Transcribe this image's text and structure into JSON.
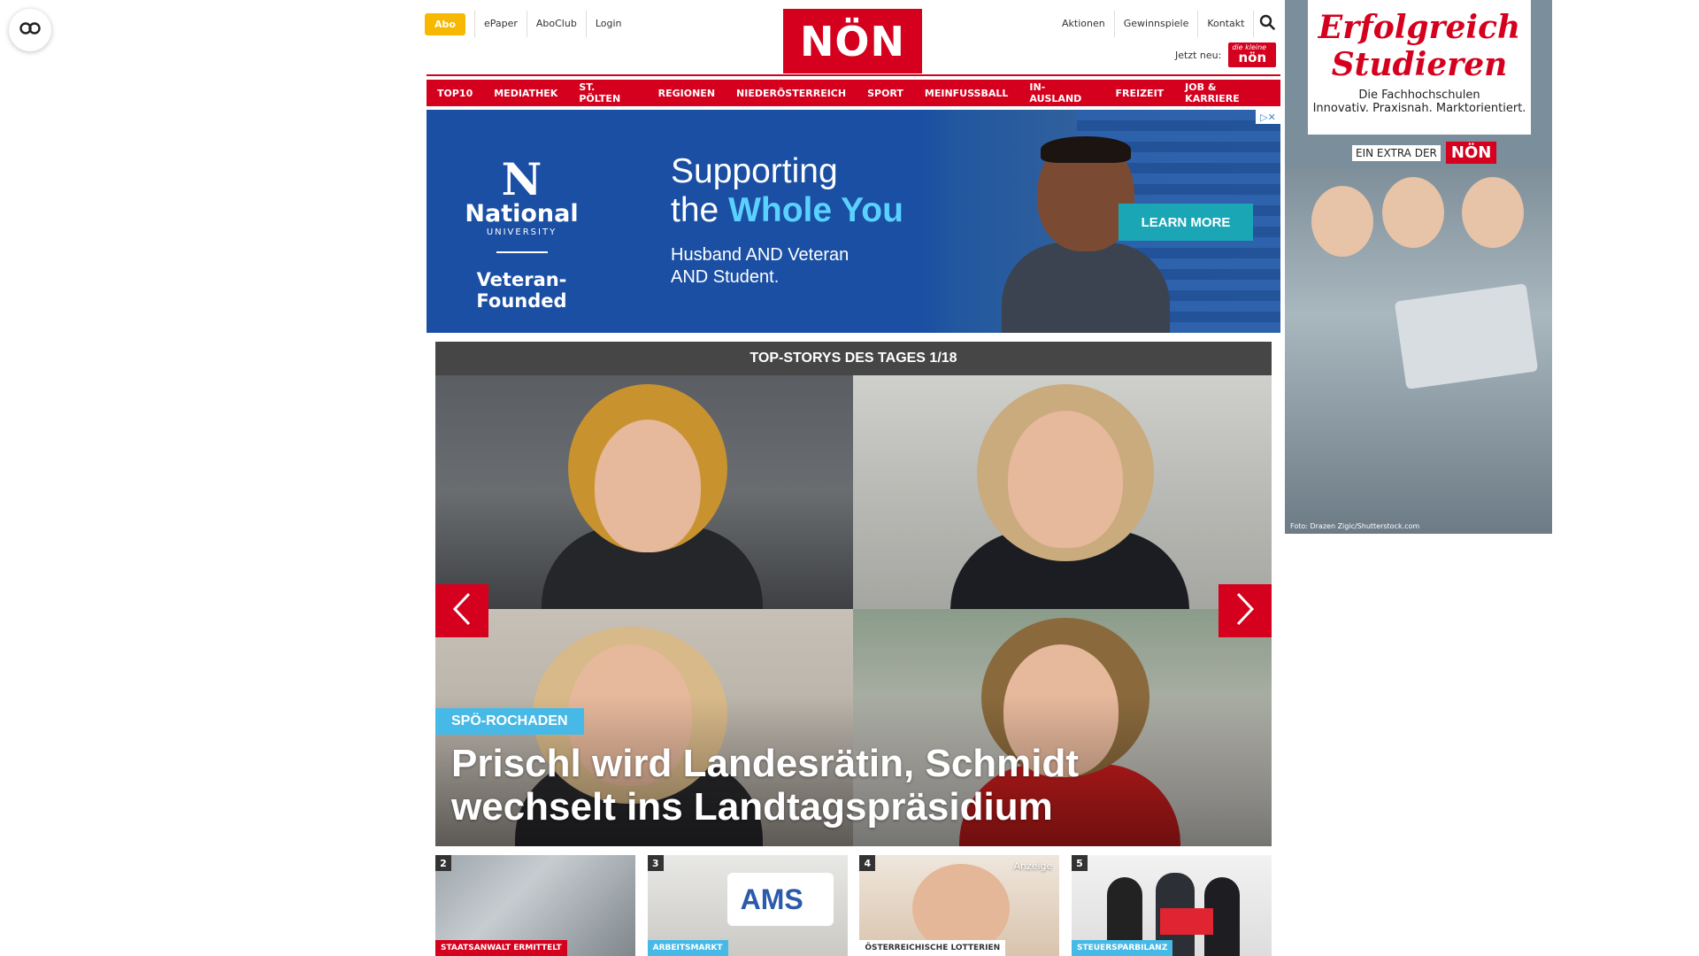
{
  "header": {
    "abo": "Abo",
    "top_links": [
      "ePaper",
      "AboClub",
      "Login"
    ],
    "logo": "NÖN",
    "right_links": [
      "Aktionen",
      "Gewinnspiele",
      "Kontakt"
    ],
    "jetzt_label": "Jetzt neu:",
    "jetzt_logo": "nön",
    "jetzt_logo_mini": "die kleine"
  },
  "nav": [
    "TOP10",
    "MEDIATHEK",
    "ST. PÖLTEN",
    "REGIONEN",
    "NIEDERÖSTERREICH",
    "SPORT",
    "MEINFUSSBALL",
    "IN-AUSLAND",
    "FREIZEIT",
    "JOB & KARRIERE"
  ],
  "banner": {
    "mark": "N",
    "brand": "National",
    "brand_sub": "UNIVERSITY",
    "tagline": "Veteran-Founded",
    "headline_1": "Supporting",
    "headline_2a": "the ",
    "headline_2b": "Whole You",
    "sub_1": "Husband AND Veteran",
    "sub_2": "AND Student.",
    "cta": "LEARN MORE",
    "adchoice": "▷✕"
  },
  "stories": {
    "heading": "TOP-STORYS DES TAGES 1/18",
    "tag": "SPÖ-ROCHADEN",
    "title": "Prischl wird Landesrätin, Schmidt wechselt ins Landtagspräsidium"
  },
  "thumbs": [
    {
      "num": "2",
      "label": "STAATSANWALT ERMITTELT",
      "ad": ""
    },
    {
      "num": "3",
      "label": "ARBEITSMARKT",
      "ad": ""
    },
    {
      "num": "4",
      "label": "ÖSTERREICHISCHE LOTTERIEN",
      "ad": "Anzeige"
    },
    {
      "num": "5",
      "label": "STEUERSPARBILANZ",
      "ad": ""
    }
  ],
  "side_ad": {
    "title_1": "Erfolgreich",
    "title_2": "Studieren",
    "sub_1": "Die Fachhochschulen",
    "sub_2": "Innovativ. Praxisnah. Marktorientiert.",
    "extra_label": "EIN EXTRA DER",
    "extra_logo": "NÖN",
    "credit": "Foto: Drazen Zigic/Shutterstock.com"
  },
  "colors": {
    "brand_red": "#d4001e",
    "abo_yellow": "#f6b800",
    "tag_blue": "#47b9e6",
    "banner_blue": "#1a4fa3"
  }
}
